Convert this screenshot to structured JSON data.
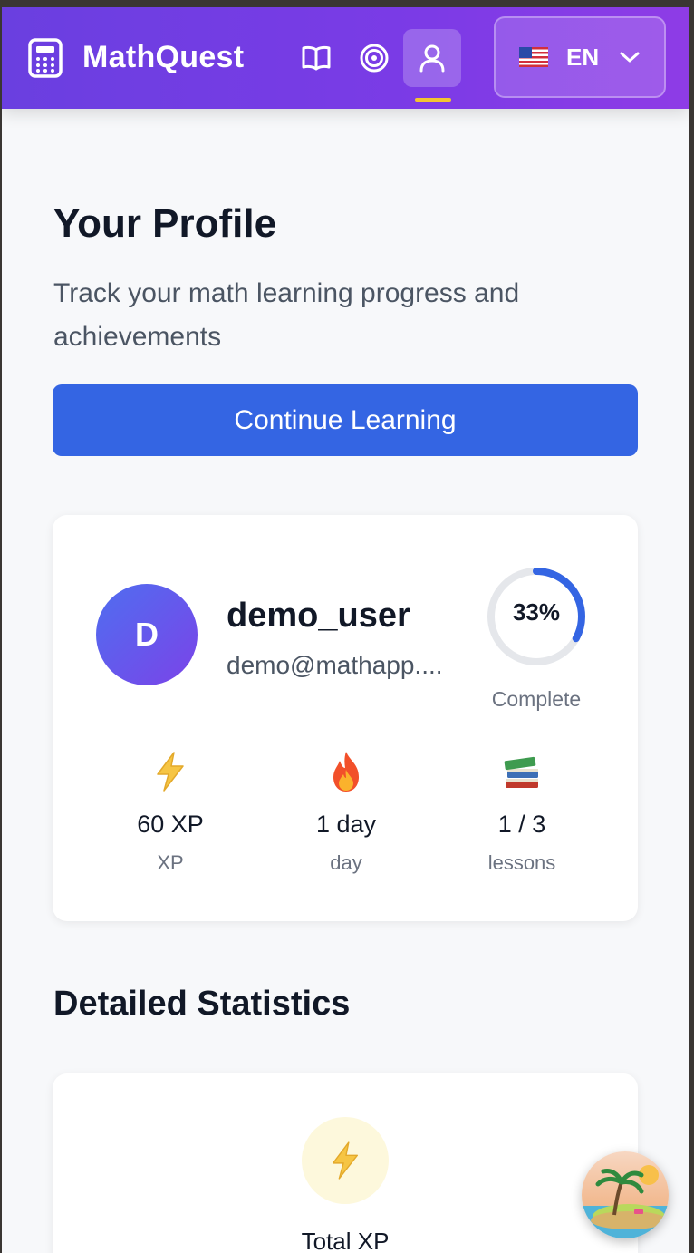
{
  "app": {
    "name": "MathQuest",
    "brand_color": "#7b3be6",
    "accent_underline": "#f3c531"
  },
  "nav": {
    "items": [
      {
        "id": "lessons",
        "icon": "book-icon",
        "active": false
      },
      {
        "id": "goals",
        "icon": "target-icon",
        "active": false
      },
      {
        "id": "profile",
        "icon": "user-icon",
        "active": true
      }
    ]
  },
  "language": {
    "code": "EN",
    "flag": "us-flag-icon"
  },
  "profile_page": {
    "title": "Your Profile",
    "subtitle": "Track your math learning progress and achievements",
    "cta_label": "Continue Learning",
    "cta_color": "#3465e3"
  },
  "user": {
    "initial": "D",
    "username": "demo_user",
    "email": "demo@mathapp....",
    "progress_percent": 33,
    "progress_label": "33%",
    "progress_caption": "Complete"
  },
  "stats": [
    {
      "icon": "lightning-icon",
      "value": "60 XP",
      "label": "XP"
    },
    {
      "icon": "fire-icon",
      "value": "1 day",
      "label": "day"
    },
    {
      "icon": "books-icon",
      "value": "1 / 3",
      "label": "lessons"
    }
  ],
  "detailed": {
    "title": "Detailed Statistics",
    "total_xp_label": "Total XP"
  }
}
